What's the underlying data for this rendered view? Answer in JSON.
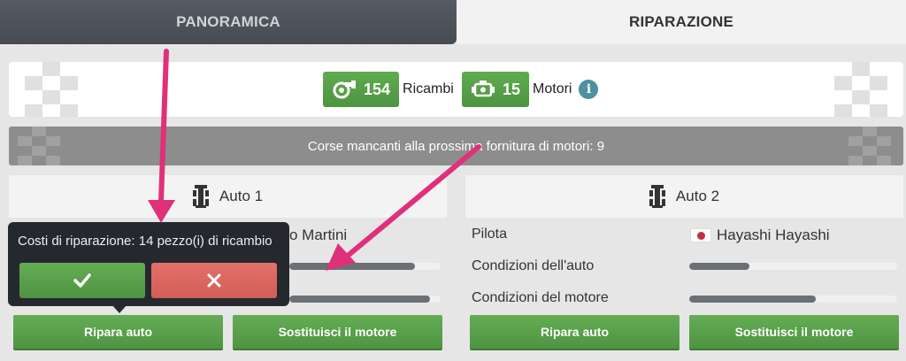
{
  "tabs": {
    "overview": "PANORAMICA",
    "repair": "RIPARAZIONE"
  },
  "resources": {
    "parts_count": "154",
    "parts_label": "Ricambi",
    "engines_count": "15",
    "engines_label": "Motori",
    "info_icon": "i"
  },
  "races_info": "Corse mancanti alla prossima fornitura di motori: 9",
  "car1": {
    "title": "Auto 1",
    "driver_name_visible": "o Martini",
    "car_condition": 0.83,
    "engine_condition": 0.93,
    "repair_label": "Ripara auto",
    "replace_engine_label": "Sostituisci il motore"
  },
  "car2": {
    "title": "Auto 2",
    "pilot_label": "Pilota",
    "driver_name": "Hayashi Hayashi",
    "car_condition_label": "Condizioni dell'auto",
    "engine_condition_label": "Condizioni del motore",
    "car_condition": 0.29,
    "engine_condition": 0.61,
    "repair_label": "Ripara auto",
    "replace_engine_label": "Sostituisci il motore"
  },
  "popup": {
    "text": "Costi di riparazione: 14 pezzo(i) di ricambio",
    "confirm_icon": "check-icon",
    "cancel_icon": "close-icon"
  },
  "colors": {
    "green": "#5aa44b",
    "red": "#dd6862",
    "dark_tab": "#4e535a",
    "annotation": "#e0307a"
  }
}
